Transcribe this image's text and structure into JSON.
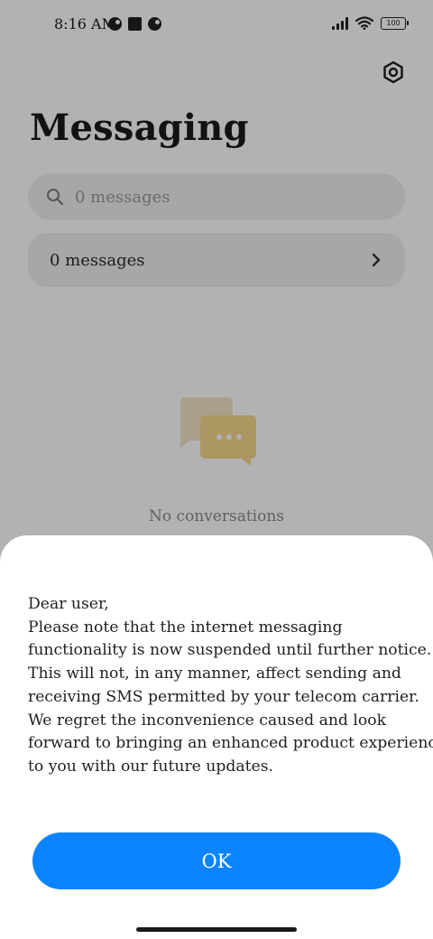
{
  "status_bar": {
    "time": "8:16 AM",
    "battery": "100"
  },
  "header": {
    "title": "Messaging"
  },
  "search": {
    "placeholder": "0 messages"
  },
  "messages_row": {
    "label": "0 messages"
  },
  "empty_state": {
    "text": "No conversations"
  },
  "dialog": {
    "lines": [
      "Dear user,",
      "Please note that the internet messaging",
      "functionality is now suspended until further notice.",
      "This will not, in any manner, affect sending and",
      "receiving SMS permitted by your telecom carrier.",
      "We regret the inconvenience caused and look",
      "forward to bringing an enhanced product experience",
      "to you with our future updates."
    ],
    "ok_label": "OK"
  },
  "colors": {
    "accent": "#0d84ff",
    "illustration_back": "#f3e6c8",
    "illustration_front": "#f7d98e"
  }
}
